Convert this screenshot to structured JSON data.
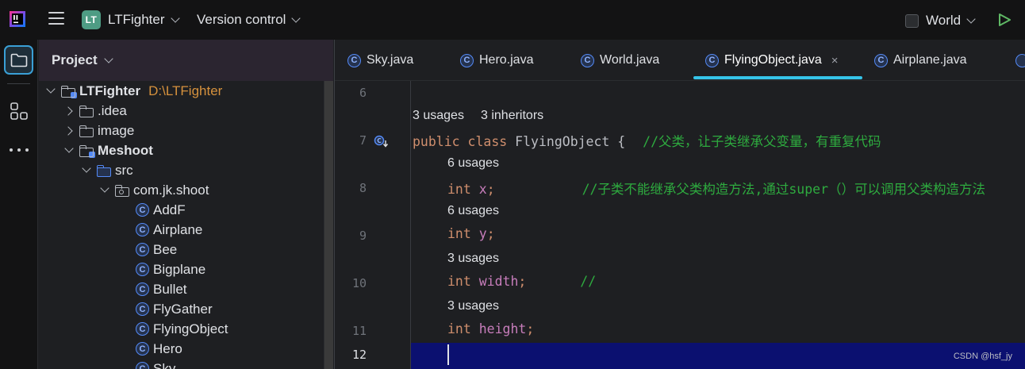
{
  "topbar": {
    "project_badge": "LT",
    "project_name": "LTFighter",
    "vcs_label": "Version control",
    "run_config": "World"
  },
  "project_panel": {
    "title": "Project",
    "tree": [
      {
        "label": "LTFighter",
        "path": "D:\\LTFighter",
        "kind": "module",
        "state": "open"
      },
      {
        "label": ".idea",
        "kind": "folder",
        "state": "closed"
      },
      {
        "label": "image",
        "kind": "folder",
        "state": "closed"
      },
      {
        "label": "Meshoot",
        "kind": "module",
        "state": "open"
      },
      {
        "label": "src",
        "kind": "source-folder",
        "state": "open"
      },
      {
        "label": "com.jk.shoot",
        "kind": "package",
        "state": "open"
      },
      {
        "label": "AddF",
        "kind": "class"
      },
      {
        "label": "Airplane",
        "kind": "class"
      },
      {
        "label": "Bee",
        "kind": "class"
      },
      {
        "label": "Bigplane",
        "kind": "class"
      },
      {
        "label": "Bullet",
        "kind": "class"
      },
      {
        "label": "FlyGather",
        "kind": "class"
      },
      {
        "label": "FlyingObject",
        "kind": "class"
      },
      {
        "label": "Hero",
        "kind": "class"
      },
      {
        "label": "Sky",
        "kind": "class"
      }
    ]
  },
  "editor": {
    "tabs": [
      {
        "label": "Sky.java",
        "active": false
      },
      {
        "label": "Hero.java",
        "active": false
      },
      {
        "label": "World.java",
        "active": false
      },
      {
        "label": "FlyingObject.java",
        "active": true
      },
      {
        "label": "Airplane.java",
        "active": false
      }
    ],
    "tab_close_glyph": "×",
    "class_icon_letter": "C",
    "lines": {
      "n6": "6",
      "n7": "7",
      "n8": "8",
      "n9": "9",
      "n10": "10",
      "n11": "11",
      "n12": "12"
    },
    "hints": {
      "class_usages": "3 usages",
      "class_inheritors": "3 inheritors",
      "x_usages": "6 usages",
      "y_usages": "6 usages",
      "width_usages": "3 usages",
      "height_usages": "3 usages"
    },
    "code": {
      "l7_kw1": "public",
      "l7_kw2": "class",
      "l7_name": "FlyingObject {",
      "l7_comment": "//父类，让子类继承父变量，有重复代码",
      "l8_kw": "int",
      "l8_field": "x",
      "l8_semi": ";",
      "l8_comment": "//子类不能继承父类构造方法,通过super（）可以调用父类构造方法",
      "l9_kw": "int",
      "l9_field": "y",
      "l9_semi": ";",
      "l10_kw": "int",
      "l10_field": "width",
      "l10_semi": ";",
      "l10_comment": "//",
      "l11_kw": "int",
      "l11_field": "height",
      "l11_semi": ";"
    },
    "current_line": 12
  },
  "watermark": "CSDN @hsf_jy",
  "colors": {
    "tab_underline": "#35c3e8",
    "current_line_bg": "#0b1070",
    "keyword": "#cf8e6d",
    "field": "#c77dbb",
    "comment": "#2eab3f",
    "path": "#d5913d",
    "project_badge": "#4e9c84"
  },
  "icons": [
    "intellij-logo-icon",
    "hamburger-menu-icon",
    "chevron-down-icon",
    "run-icon",
    "project-tool-icon",
    "structure-tool-icon",
    "more-tools-icon",
    "folder-icon",
    "module-icon",
    "package-icon",
    "class-icon",
    "implemented-method-gutter-icon",
    "close-icon"
  ]
}
